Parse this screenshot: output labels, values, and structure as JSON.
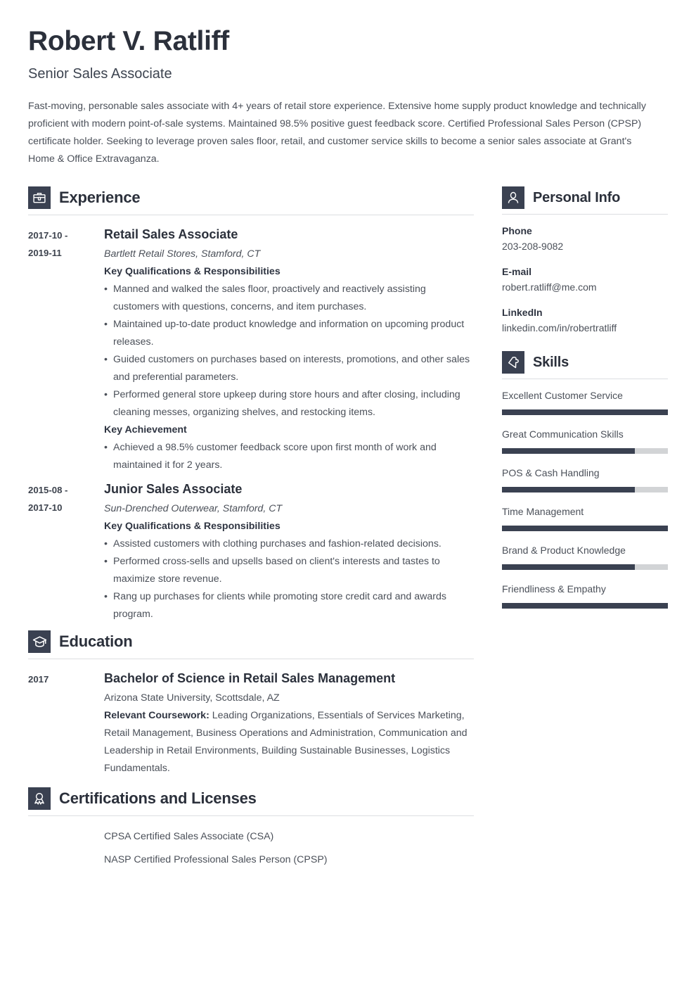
{
  "header": {
    "name": "Robert V. Ratliff",
    "job_title": "Senior Sales Associate",
    "summary": "Fast-moving, personable sales associate with 4+ years of retail store experience. Extensive home supply product knowledge and technically proficient with modern point-of-sale systems. Maintained 98.5% positive guest feedback score. Certified Professional Sales Person (CPSP) certificate holder. Seeking to leverage proven sales floor, retail, and customer service skills to become a senior sales associate at Grant's Home & Office Extravaganza."
  },
  "colors": {
    "accent_dark": "#3a4151",
    "heading": "#2b303b",
    "body_text": "#4b5059",
    "rule": "#dcdee1",
    "skill_track": "#d2d4d6"
  },
  "sections": {
    "experience": {
      "title": "Experience",
      "icon": "briefcase-icon",
      "entries": [
        {
          "dates": "2017-10 - 2019-11",
          "dates_line1": "2017-10 -",
          "dates_line2": "2019-11",
          "role": "Retail Sales Associate",
          "org": "Bartlett Retail Stores, Stamford, CT",
          "qualifications_label": "Key Qualifications & Responsibilities",
          "qualifications": [
            "Manned and walked the sales floor, proactively and reactively assisting customers with questions, concerns, and item purchases.",
            "Maintained up-to-date product knowledge and information on upcoming product releases.",
            "Guided customers on purchases based on interests, promotions, and other sales and preferential parameters.",
            "Performed general store upkeep during store hours and after closing, including cleaning messes, organizing shelves, and restocking items."
          ],
          "achievement_label": "Key Achievement",
          "achievements": [
            "Achieved a 98.5% customer feedback score upon first month of work and maintained it for 2 years."
          ]
        },
        {
          "dates": "2015-08 - 2017-10",
          "dates_line1": "2015-08 -",
          "dates_line2": "2017-10",
          "role": "Junior Sales Associate",
          "org": "Sun-Drenched Outerwear, Stamford, CT",
          "qualifications_label": "Key Qualifications & Responsibilities",
          "qualifications": [
            "Assisted customers with clothing purchases and fashion-related decisions.",
            "Performed cross-sells and upsells based on client's interests and tastes to maximize store revenue.",
            "Rang up purchases for clients while promoting store credit card and awards program."
          ]
        }
      ]
    },
    "education": {
      "title": "Education",
      "icon": "graduation-cap-icon",
      "entries": [
        {
          "dates": "2017",
          "degree": "Bachelor of Science in Retail Sales Management",
          "school": "Arizona State University, Scottsdale, AZ",
          "coursework_label": "Relevant Coursework:",
          "coursework": "Leading Organizations, Essentials of Services Marketing, Retail Management, Business Operations and Administration, Communication and Leadership in Retail Environments, Building Sustainable Businesses, Logistics Fundamentals."
        }
      ]
    },
    "certifications": {
      "title": "Certifications and Licenses",
      "icon": "award-ribbon-icon",
      "items": [
        "CPSA Certified Sales Associate (CSA)",
        "NASP Certified Professional Sales Person (CPSP)"
      ]
    },
    "personal_info": {
      "title": "Personal Info",
      "icon": "person-icon",
      "fields": [
        {
          "label": "Phone",
          "value": "203-208-9082"
        },
        {
          "label": "E-mail",
          "value": "robert.ratliff@me.com"
        },
        {
          "label": "LinkedIn",
          "value": "linkedin.com/in/robertratliff"
        }
      ]
    },
    "skills": {
      "title": "Skills",
      "icon": "puzzle-piece-icon",
      "items": [
        {
          "name": "Excellent Customer Service",
          "level": 100
        },
        {
          "name": "Great Communication Skills",
          "level": 80
        },
        {
          "name": "POS & Cash Handling",
          "level": 80
        },
        {
          "name": "Time Management",
          "level": 100
        },
        {
          "name": "Brand & Product Knowledge",
          "level": 80
        },
        {
          "name": "Friendliness & Empathy",
          "level": 100
        }
      ]
    }
  }
}
